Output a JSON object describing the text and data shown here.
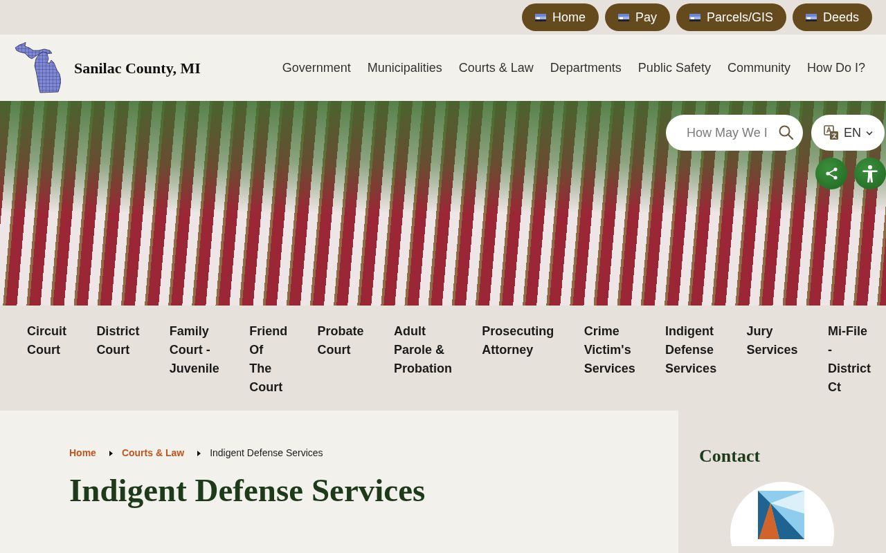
{
  "top_links": [
    {
      "label": "Home"
    },
    {
      "label": "Pay"
    },
    {
      "label": "Parcels/GIS"
    },
    {
      "label": "Deeds"
    }
  ],
  "header": {
    "site_name": "Sanilac County, MI",
    "nav": [
      {
        "label": "Government"
      },
      {
        "label": "Municipalities"
      },
      {
        "label": "Courts & Law"
      },
      {
        "label": "Departments"
      },
      {
        "label": "Public Safety"
      },
      {
        "label": "Community"
      },
      {
        "label": "How Do I?"
      }
    ]
  },
  "hero": {
    "search": {
      "placeholder": "How May We I"
    },
    "language": {
      "label": "EN"
    }
  },
  "section_nav": [
    {
      "label": "Circuit Court"
    },
    {
      "label": "District Court"
    },
    {
      "label": "Family Court - Juvenile"
    },
    {
      "label": "Friend Of The Court"
    },
    {
      "label": "Probate Court"
    },
    {
      "label": "Adult Parole & Probation"
    },
    {
      "label": "Prosecuting Attorney"
    },
    {
      "label": "Crime Victim's Services"
    },
    {
      "label": "Indigent Defense Services"
    },
    {
      "label": "Jury Services"
    },
    {
      "label": "Mi-File - District Ct"
    }
  ],
  "breadcrumb": [
    {
      "label": "Home",
      "current": false
    },
    {
      "label": "Courts & Law",
      "current": false
    },
    {
      "label": "Indigent Defense Services",
      "current": true
    }
  ],
  "page_title": "Indigent Defense Services",
  "sidebar": {
    "heading": "Contact"
  }
}
